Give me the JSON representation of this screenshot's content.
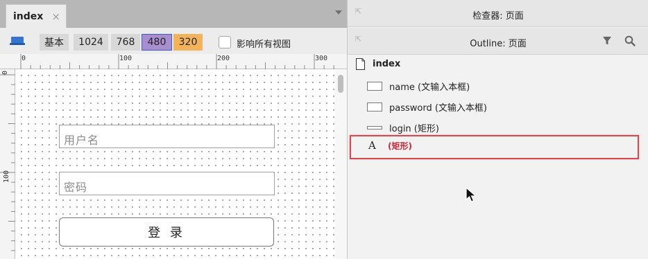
{
  "editor": {
    "tab": {
      "label": "index",
      "close": "×"
    },
    "toolbar": {
      "view_icon": "desktop-view-icon",
      "views": [
        "基本",
        "1024",
        "768",
        "480",
        "320"
      ],
      "selected_view": "480",
      "affect_all_label": "影响所有视图",
      "affect_all_checked": false,
      "colors": {
        "selected": "#a88ecf",
        "selected_border": "#3b5bcf",
        "view_320": "#f3b35a",
        "inactive": "#d8d8d8"
      }
    },
    "ruler": {
      "h_labels": [
        "0",
        "100",
        "200",
        "300"
      ],
      "v_labels": [
        "0",
        "100"
      ]
    },
    "canvas": {
      "username_placeholder": "用户名",
      "password_placeholder": "密码",
      "login_label": "登 录"
    }
  },
  "inspector": {
    "title": "检查器: 页面"
  },
  "outline": {
    "title": "Outline: 页面",
    "items": [
      {
        "label": "index",
        "icon": "page-icon"
      },
      {
        "label": "name (文输入本框)",
        "icon": "textbox-icon"
      },
      {
        "label": "password (文输入本框)",
        "icon": "textbox-icon"
      },
      {
        "label": "login (矩形)",
        "icon": "rectangle-icon"
      },
      {
        "label": "(矩形)",
        "icon": "text-icon",
        "highlighted": true,
        "color": "#d0263a"
      }
    ],
    "highlight_color": "#d44a4f"
  }
}
